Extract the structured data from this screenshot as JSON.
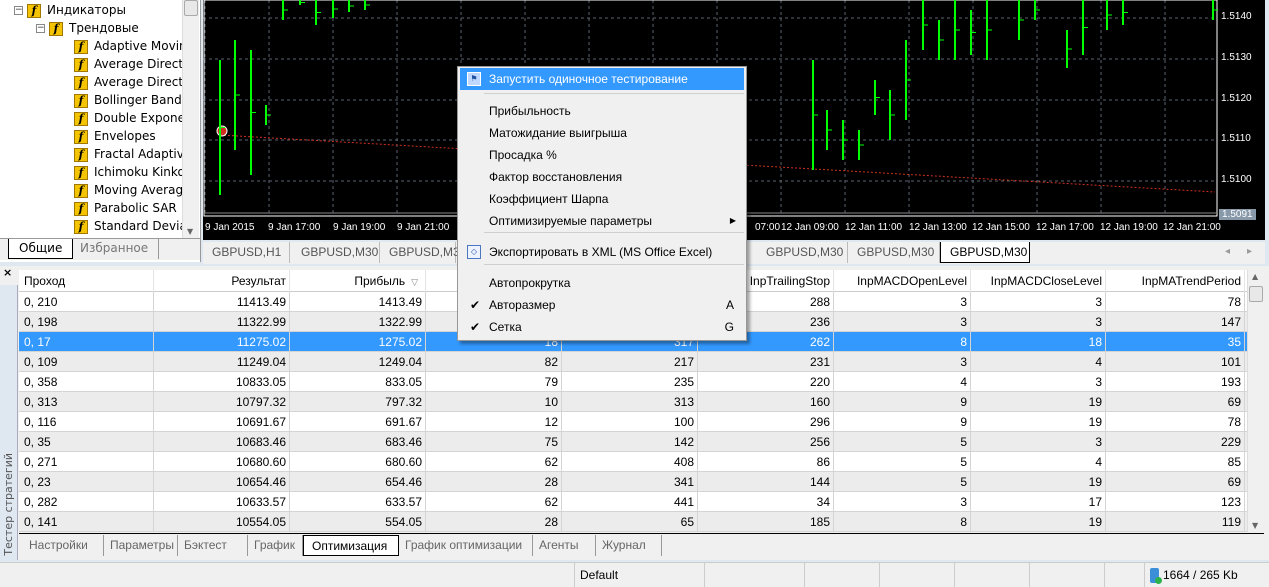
{
  "navigator": {
    "root": "Индикаторы",
    "group": "Трендовые",
    "items": [
      "Adaptive Moving Average",
      "Average Directional Movement Index",
      "Average Directional Movement Index Wilder",
      "Bollinger Bands",
      "Double Exponential Moving Average",
      "Envelopes",
      "Fractal Adaptive Moving Average",
      "Ichimoku Kinko Hyo",
      "Moving Average",
      "Parabolic SAR",
      "Standard Deviation"
    ],
    "tabs": [
      "Общие",
      "Избранное"
    ],
    "active_tab": 0
  },
  "chart": {
    "background": "#000000",
    "bar_color": "#00ff00",
    "price_labels": [
      "1.5140",
      "1.5130",
      "1.5120",
      "1.5110",
      "1.5100"
    ],
    "current_price": "1.5091",
    "time_labels": [
      "9 Jan 2015",
      "9 Jan 17:00",
      "9 Jan 19:00",
      "9 Jan 21:00",
      "07:00",
      "12 Jan 09:00",
      "12 Jan 11:00",
      "12 Jan 13:00",
      "12 Jan 15:00",
      "12 Jan 17:00",
      "12 Jan 19:00",
      "12 Jan 21:00"
    ],
    "tabs": [
      "GBPUSD,H1",
      "GBPUSD,M30",
      "GBPUSD,M3",
      "GBPUSD,M30",
      "GBPUSD,M30",
      "GBPUSD,M30"
    ],
    "active_tab": 5
  },
  "context_menu": {
    "items": [
      {
        "label": "Запустить одиночное тестирование",
        "icon": "run-test-icon",
        "highlighted": true
      },
      {
        "label": "Прибыльность"
      },
      {
        "label": "Матожидание выигрыша"
      },
      {
        "label": "Просадка %"
      },
      {
        "label": "Фактор восстановления"
      },
      {
        "label": "Коэффициент Шарпа"
      },
      {
        "label": "Оптимизируемые параметры",
        "submenu": true
      },
      {
        "label": "Экспортировать в XML (MS Office Excel)",
        "icon": "xml-export-icon"
      },
      {
        "label": "Автопрокрутка"
      },
      {
        "label": "Авторазмер",
        "checked": true,
        "shortcut": "A"
      },
      {
        "label": "Сетка",
        "checked": true,
        "shortcut": "G"
      }
    ]
  },
  "tester": {
    "panel_title": "Тестер стратегий",
    "columns": [
      "Проход",
      "Результат",
      "Прибыль",
      "",
      "",
      "InpTrailingStop",
      "InpMACDOpenLevel",
      "InpMACDCloseLevel",
      "InpMATrendPeriod"
    ],
    "sort_column": 2,
    "selected_row": 2,
    "rows": [
      [
        "0, 210",
        "11413.49",
        "1413.49",
        "",
        "",
        "288",
        "3",
        "3",
        "78"
      ],
      [
        "0, 198",
        "11322.99",
        "1322.99",
        "",
        "",
        "236",
        "3",
        "3",
        "147"
      ],
      [
        "0, 17",
        "11275.02",
        "1275.02",
        "18",
        "317",
        "262",
        "8",
        "18",
        "35"
      ],
      [
        "0, 109",
        "11249.04",
        "1249.04",
        "82",
        "217",
        "231",
        "3",
        "4",
        "101"
      ],
      [
        "0, 358",
        "10833.05",
        "833.05",
        "79",
        "235",
        "220",
        "4",
        "3",
        "193"
      ],
      [
        "0, 313",
        "10797.32",
        "797.32",
        "10",
        "313",
        "160",
        "9",
        "19",
        "69"
      ],
      [
        "0, 116",
        "10691.67",
        "691.67",
        "12",
        "100",
        "296",
        "9",
        "19",
        "78"
      ],
      [
        "0, 35",
        "10683.46",
        "683.46",
        "75",
        "142",
        "256",
        "5",
        "3",
        "229"
      ],
      [
        "0, 271",
        "10680.60",
        "680.60",
        "62",
        "408",
        "86",
        "5",
        "4",
        "85"
      ],
      [
        "0, 23",
        "10654.46",
        "654.46",
        "28",
        "341",
        "144",
        "5",
        "19",
        "69"
      ],
      [
        "0, 282",
        "10633.57",
        "633.57",
        "62",
        "441",
        "34",
        "3",
        "17",
        "123"
      ],
      [
        "0, 141",
        "10554.05",
        "554.05",
        "28",
        "65",
        "185",
        "8",
        "19",
        "119"
      ]
    ],
    "tabs": [
      "Настройки",
      "Параметры",
      "Бэктест",
      "График",
      "Оптимизация",
      "График оптимизации",
      "Агенты",
      "Журнал"
    ],
    "active_tab": 4
  },
  "statusbar": {
    "profile": "Default",
    "traffic": "1664 / 265 Kb"
  },
  "colors": {
    "selection": "#3399ff",
    "menu_bg": "#f0f0f0"
  }
}
